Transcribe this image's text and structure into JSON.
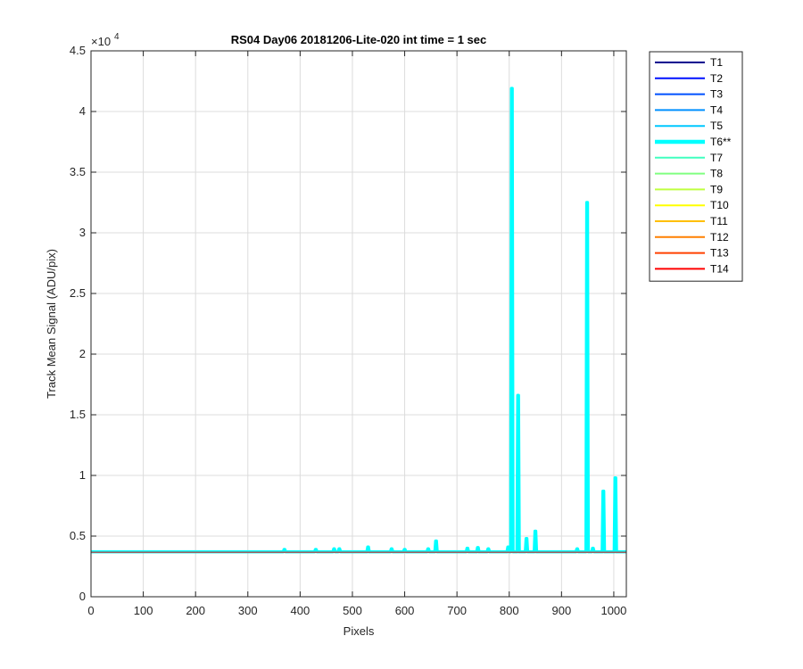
{
  "chart_data": {
    "type": "line",
    "title": "RS04 Day06 20181206-Lite-020 int time = 1 sec",
    "xlabel": "Pixels",
    "ylabel": "Track Mean Signal (ADU/pix)",
    "y_exponent_label": "×10",
    "y_exponent_power": "4",
    "xlim": [
      0,
      1024
    ],
    "ylim": [
      0,
      45000
    ],
    "xticks": [
      0,
      100,
      200,
      300,
      400,
      500,
      600,
      700,
      800,
      900,
      1000
    ],
    "yticks": [
      0,
      5000,
      10000,
      15000,
      20000,
      25000,
      30000,
      35000,
      40000,
      45000
    ],
    "xtick_labels": [
      "0",
      "100",
      "200",
      "300",
      "400",
      "500",
      "600",
      "700",
      "800",
      "900",
      "1000"
    ],
    "ytick_labels": [
      "0",
      "0.5",
      "1",
      "1.5",
      "2",
      "2.5",
      "3",
      "3.5",
      "4",
      "4.5"
    ],
    "grid": true,
    "legend_position": "outside-right",
    "baseline": 3700,
    "series": [
      {
        "name": "T1",
        "color": "#00008f"
      },
      {
        "name": "T2",
        "color": "#0010ff"
      },
      {
        "name": "T3",
        "color": "#0050ff"
      },
      {
        "name": "T4",
        "color": "#0090ff"
      },
      {
        "name": "T5",
        "color": "#00c8ff"
      },
      {
        "name": "T6**",
        "color": "#00ffff",
        "highlighted": true,
        "peaks": [
          {
            "x": 370,
            "y": 3900
          },
          {
            "x": 430,
            "y": 3900
          },
          {
            "x": 465,
            "y": 3950
          },
          {
            "x": 475,
            "y": 3950
          },
          {
            "x": 530,
            "y": 4100
          },
          {
            "x": 575,
            "y": 3950
          },
          {
            "x": 600,
            "y": 3900
          },
          {
            "x": 645,
            "y": 3950
          },
          {
            "x": 660,
            "y": 4600
          },
          {
            "x": 720,
            "y": 4000
          },
          {
            "x": 740,
            "y": 4050
          },
          {
            "x": 760,
            "y": 3950
          },
          {
            "x": 798,
            "y": 4100
          },
          {
            "x": 805,
            "y": 41900
          },
          {
            "x": 817,
            "y": 16600
          },
          {
            "x": 833,
            "y": 4800
          },
          {
            "x": 850,
            "y": 5400
          },
          {
            "x": 930,
            "y": 3950
          },
          {
            "x": 949,
            "y": 32500
          },
          {
            "x": 960,
            "y": 4000
          },
          {
            "x": 980,
            "y": 8700
          },
          {
            "x": 1003,
            "y": 9800
          }
        ]
      },
      {
        "name": "T7",
        "color": "#40ffbf"
      },
      {
        "name": "T8",
        "color": "#80ff80"
      },
      {
        "name": "T9",
        "color": "#bfff40"
      },
      {
        "name": "T10",
        "color": "#ffff00"
      },
      {
        "name": "T11",
        "color": "#ffbf00"
      },
      {
        "name": "T12",
        "color": "#ff8000"
      },
      {
        "name": "T13",
        "color": "#ff4000"
      },
      {
        "name": "T14",
        "color": "#ff0000"
      }
    ]
  }
}
